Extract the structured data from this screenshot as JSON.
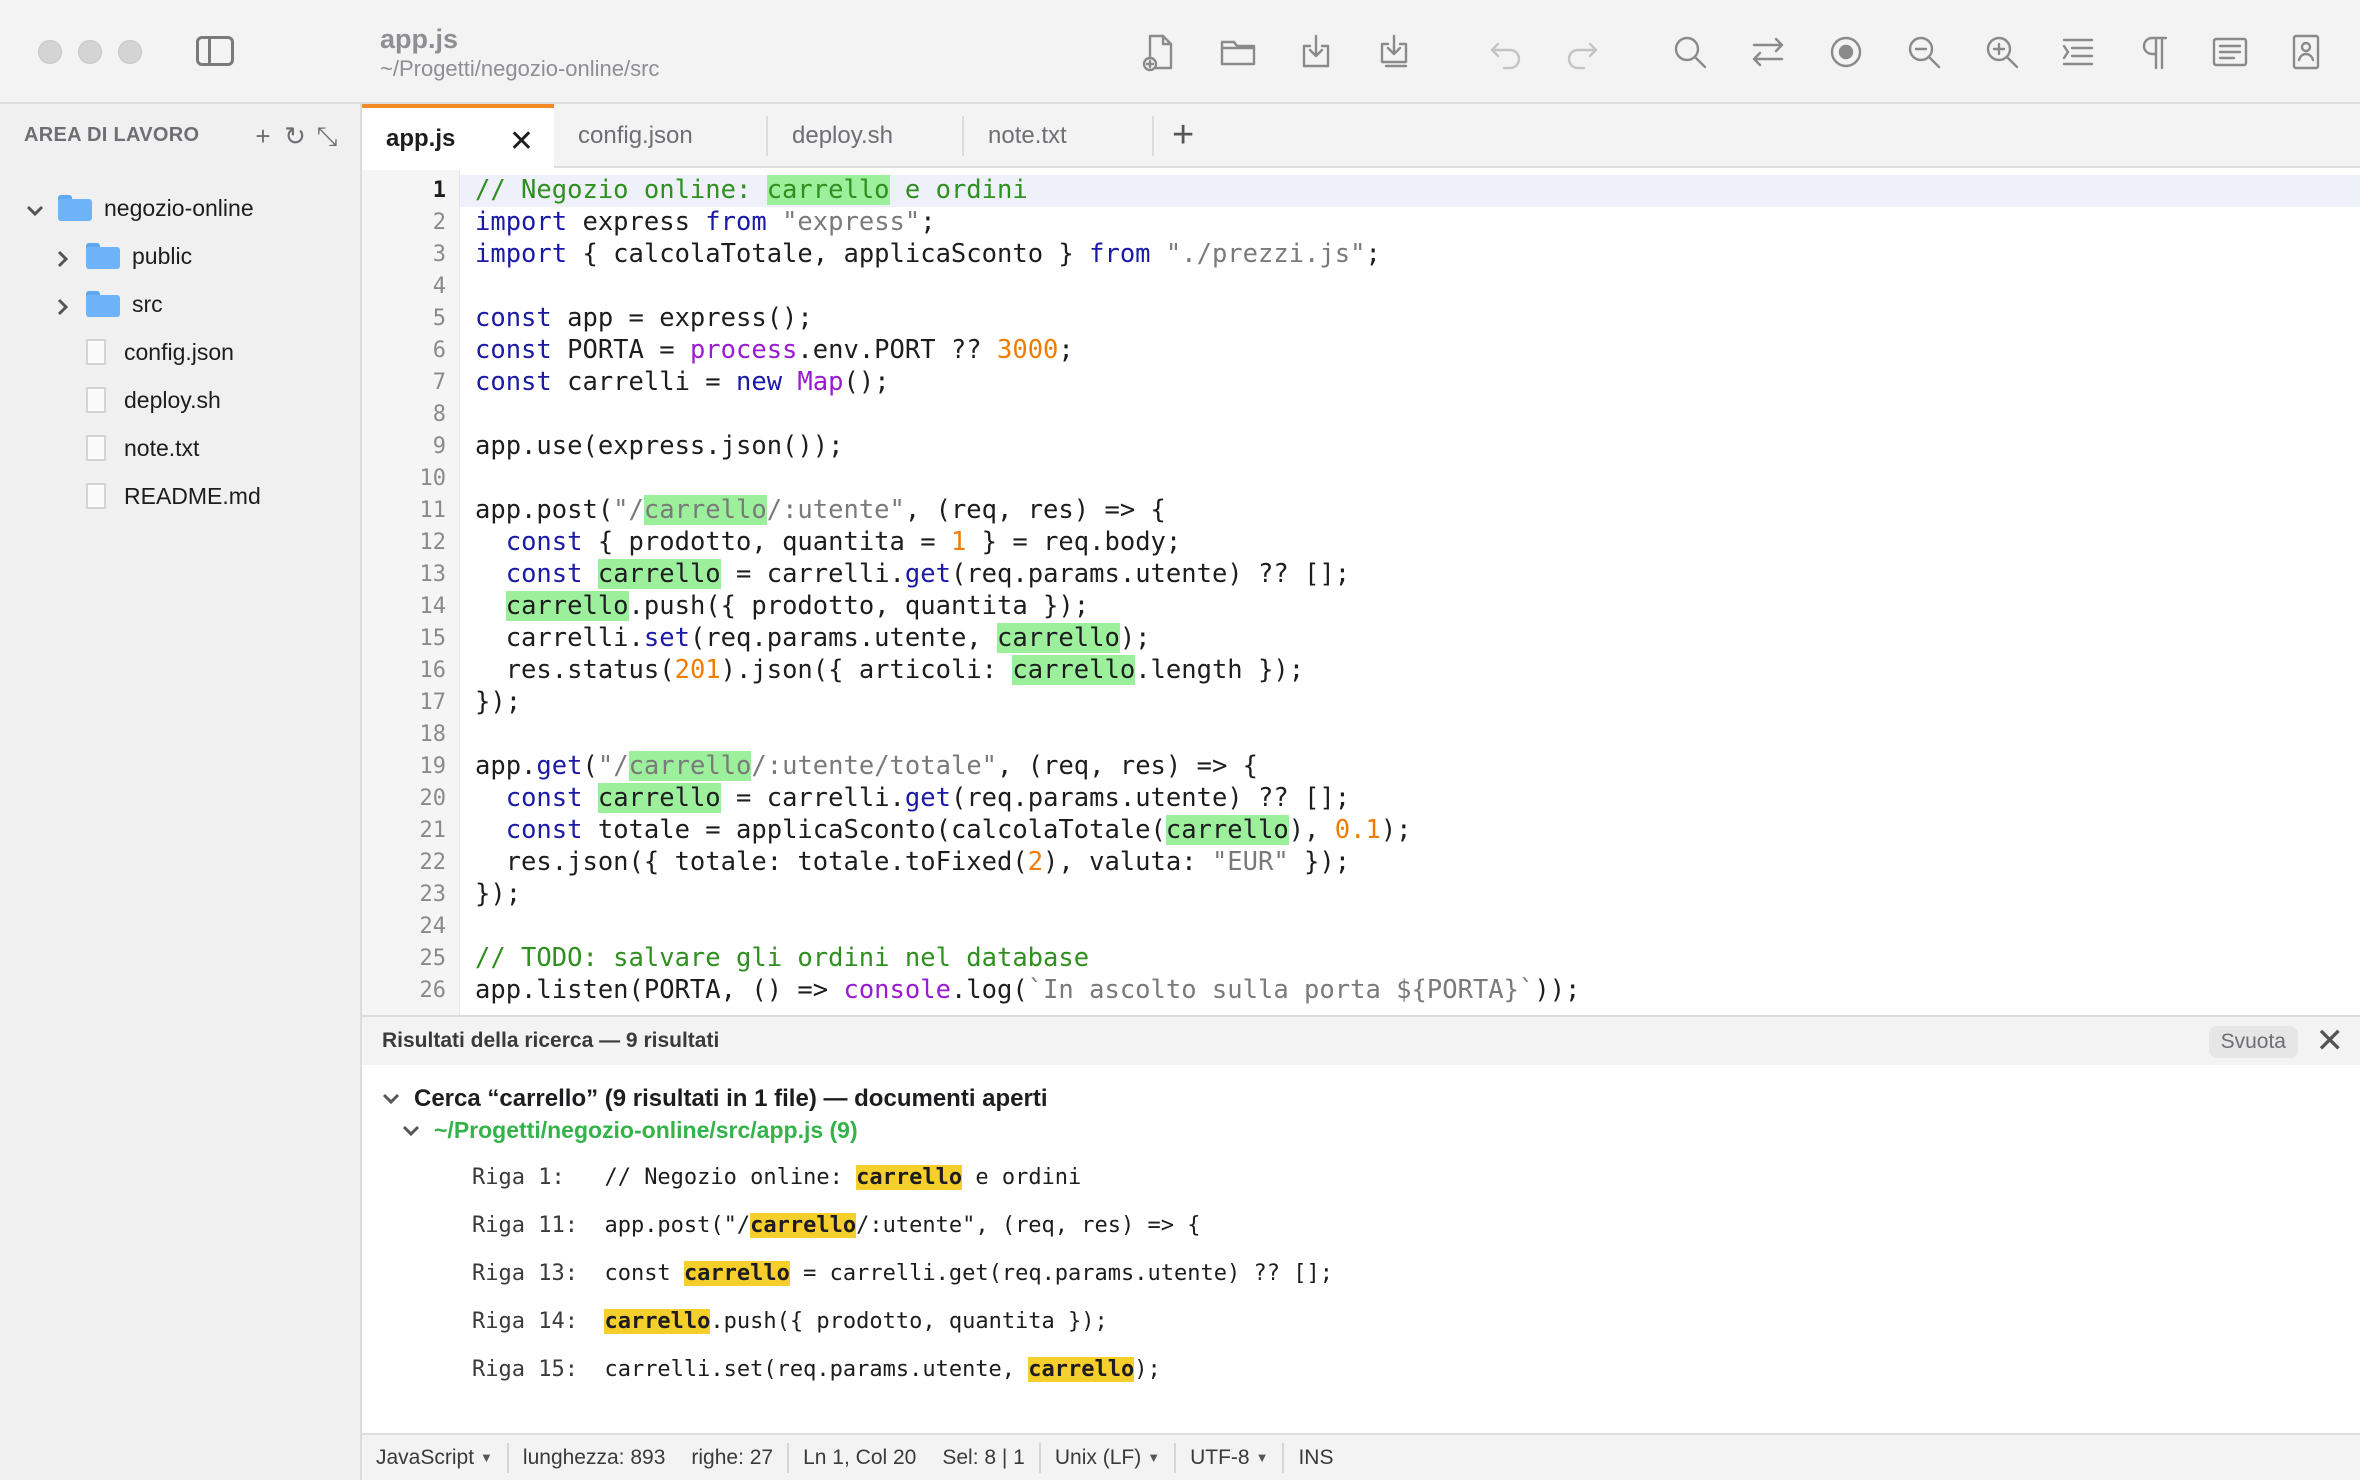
{
  "window": {
    "title": "app.js",
    "path": "~/Progetti/negozio-online/src"
  },
  "sidebar": {
    "title": "AREA DI LAVORO",
    "items": [
      {
        "label": "negozio-online",
        "type": "folder",
        "expanded": true
      },
      {
        "label": "public",
        "type": "folder",
        "expanded": false
      },
      {
        "label": "src",
        "type": "folder",
        "expanded": false
      },
      {
        "label": "config.json",
        "type": "file"
      },
      {
        "label": "deploy.sh",
        "type": "file"
      },
      {
        "label": "note.txt",
        "type": "file"
      },
      {
        "label": "README.md",
        "type": "file"
      }
    ]
  },
  "tabs": [
    {
      "label": "app.js",
      "active": true
    },
    {
      "label": "config.json",
      "active": false
    },
    {
      "label": "deploy.sh",
      "active": false
    },
    {
      "label": "note.txt",
      "active": false
    }
  ],
  "editor": {
    "current_line": 1,
    "lines": [
      "// Negozio online: carrello e ordini",
      "import express from \"express\";",
      "import { calcolaTotale, applicaSconto } from \"./prezzi.js\";",
      "",
      "const app = express();",
      "const PORTA = process.env.PORT ?? 3000;",
      "const carrelli = new Map();",
      "",
      "app.use(express.json());",
      "",
      "app.post(\"/carrello/:utente\", (req, res) => {",
      "  const { prodotto, quantita = 1 } = req.body;",
      "  const carrello = carrelli.get(req.params.utente) ?? [];",
      "  carrello.push({ prodotto, quantita });",
      "  carrelli.set(req.params.utente, carrello);",
      "  res.status(201).json({ articoli: carrello.length });",
      "});",
      "",
      "app.get(\"/carrello/:utente/totale\", (req, res) => {",
      "  const carrello = carrelli.get(req.params.utente) ?? [];",
      "  const totale = applicaSconto(calcolaTotale(carrello), 0.1);",
      "  res.json({ totale: totale.toFixed(2), valuta: \"EUR\" });",
      "});",
      "",
      "// TODO: salvare gli ordini nel database",
      "app.listen(PORTA, () => console.log(`In ascolto sulla porta ${PORTA}`));"
    ]
  },
  "search": {
    "header": "Risultati della ricerca — 9 risultati",
    "clear_label": "Svuota",
    "query_summary": "Cerca “carrello” (9 risultati in 1 file) — documenti aperti",
    "file_label": "~/Progetti/negozio-online/src/app.js (9)",
    "term": "carrello",
    "results": [
      {
        "label": "Riga 1:",
        "text": "// Negozio online: carrello e ordini"
      },
      {
        "label": "Riga 11:",
        "text": "app.post(\"/carrello/:utente\", (req, res) => {"
      },
      {
        "label": "Riga 13:",
        "text": "const carrello = carrelli.get(req.params.utente) ?? [];"
      },
      {
        "label": "Riga 14:",
        "text": "carrello.push({ prodotto, quantita });"
      },
      {
        "label": "Riga 15:",
        "text": "carrelli.set(req.params.utente, carrello);"
      }
    ]
  },
  "statusbar": {
    "language": "JavaScript",
    "length": "lunghezza: 893",
    "lines": "righe: 27",
    "cursor": "Ln 1, Col 20",
    "selection": "Sel: 8 | 1",
    "eol": "Unix (LF)",
    "encoding": "UTF-8",
    "mode": "INS"
  },
  "colors": {
    "accent_tab": "#f08a24",
    "match_editor": "#9cf09c",
    "match_result": "#f6cf2c",
    "result_file": "#34b34a",
    "keyword": "#1a1aa6",
    "comment": "#2f8f1f",
    "number": "#f07d00",
    "builtin": "#9a1bd0"
  },
  "toolbar_icons": [
    "new-file-icon",
    "open-folder-icon",
    "save-icon",
    "save-all-icon",
    "undo-icon",
    "redo-icon",
    "search-icon",
    "replace-icon",
    "record-macro-icon",
    "zoom-out-icon",
    "zoom-in-icon",
    "indent-icon",
    "pilcrow-icon",
    "wrap-icon",
    "document-info-icon"
  ]
}
